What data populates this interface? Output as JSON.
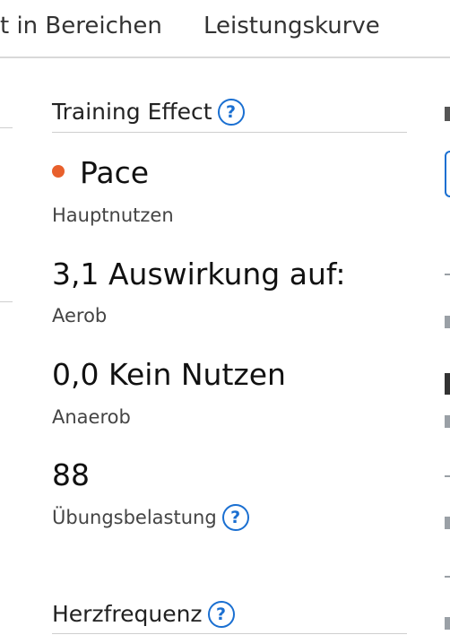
{
  "tabs": {
    "zones_partial": "t in Bereichen",
    "power_curve": "Leistungskurve"
  },
  "training_effect": {
    "title": "Training Effect",
    "primary_benefit_value": "Pace",
    "primary_benefit_label": "Hauptnutzen",
    "primary_benefit_color": "#e8602c",
    "aerobic_value": "3,1 Auswirkung auf:",
    "aerobic_label": "Aerob",
    "anaerobic_value": "0,0 Kein Nutzen",
    "anaerobic_label": "Anaerob",
    "load_value": "88",
    "load_label": "Übungsbelastung"
  },
  "heart_rate": {
    "title": "Herzfrequenz"
  },
  "icons": {
    "help": "question-circle-icon",
    "help_glyph": "?"
  },
  "colors": {
    "accent": "#1a6fd1",
    "pace_dot": "#e8602c"
  }
}
